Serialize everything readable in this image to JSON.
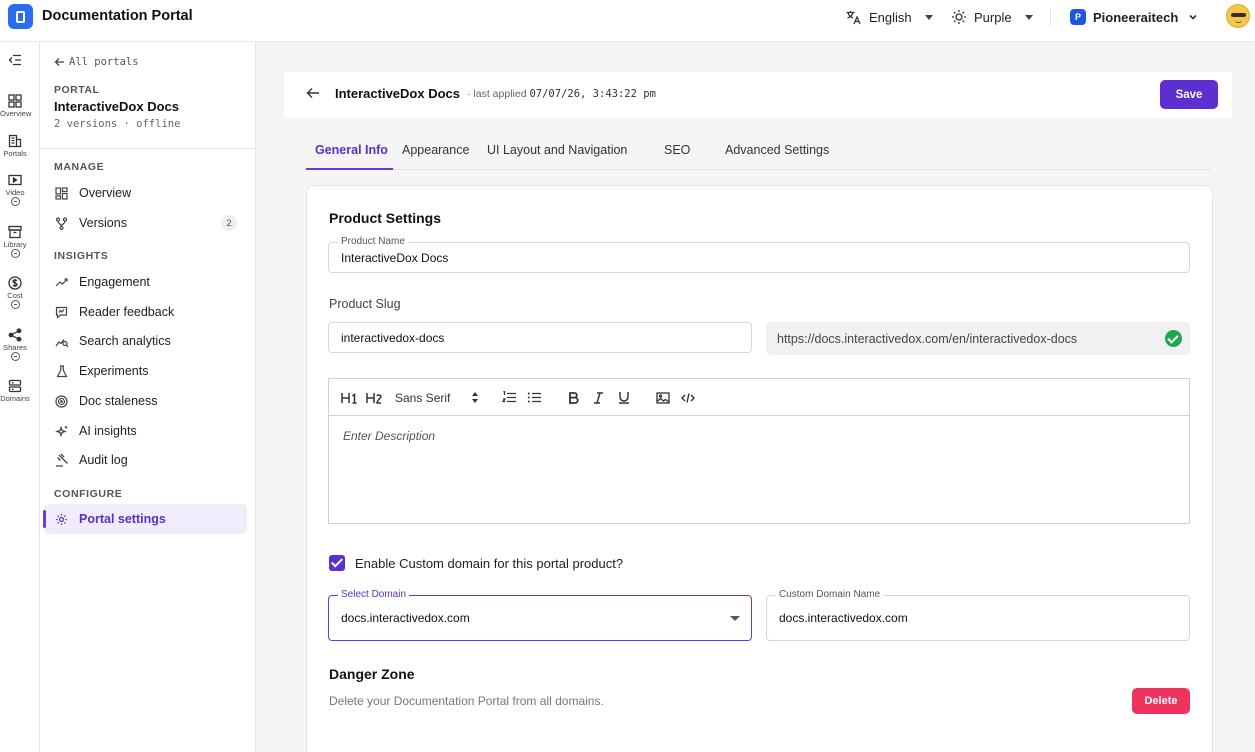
{
  "app": {
    "title": "Documentation Portal",
    "language": "English",
    "theme": "Purple",
    "org_initial": "P",
    "org_name": "Pioneeraitech"
  },
  "rail": {
    "items": [
      {
        "label": "Overview",
        "icon": "grid-icon"
      },
      {
        "label": "Portals",
        "icon": "building-icon"
      },
      {
        "label": "Video",
        "icon": "video-icon"
      },
      {
        "label": "Library",
        "icon": "archive-icon"
      },
      {
        "label": "Cost",
        "icon": "dollar-icon"
      },
      {
        "label": "Shares",
        "icon": "share-icon"
      },
      {
        "label": "Domains",
        "icon": "server-icon"
      }
    ]
  },
  "nav": {
    "back_label": "All portals",
    "portal_label": "PORTAL",
    "portal_name": "InteractiveDox Docs",
    "portal_meta": "2 versions · offline",
    "manage_title": "MANAGE",
    "insights_title": "INSIGHTS",
    "configure_title": "CONFIGURE",
    "manage": [
      {
        "label": "Overview",
        "icon": "grid-icon"
      },
      {
        "label": "Versions",
        "icon": "branch-icon",
        "count": "2"
      }
    ],
    "insights": [
      {
        "label": "Engagement",
        "icon": "trend-icon"
      },
      {
        "label": "Reader feedback",
        "icon": "feedback-icon"
      },
      {
        "label": "Search analytics",
        "icon": "search-analytics-icon"
      },
      {
        "label": "Experiments",
        "icon": "flask-icon"
      },
      {
        "label": "Doc staleness",
        "icon": "radar-icon"
      },
      {
        "label": "AI insights",
        "icon": "sparkle-icon"
      },
      {
        "label": "Audit log",
        "icon": "gavel-icon"
      }
    ],
    "configure": [
      {
        "label": "Portal settings",
        "icon": "gear-icon"
      }
    ]
  },
  "header": {
    "title": "InteractiveDox Docs",
    "last_applied_label": "· last applied",
    "last_applied_value": "07/07/26, 3:43:22 pm",
    "save_label": "Save"
  },
  "tabs": [
    "General Info",
    "Appearance",
    "UI Layout and Navigation",
    "SEO",
    "Advanced Settings"
  ],
  "form": {
    "section_title": "Product Settings",
    "product_name_label": "Product Name",
    "product_name_value": "InteractiveDox Docs",
    "slug_label": "Product Slug",
    "slug_value": "interactivedox-docs",
    "slug_url": "https://docs.interactivedox.com/en/interactivedox-docs",
    "editor": {
      "h1": "H1",
      "h2": "H2",
      "font": "Sans Serif",
      "placeholder": "Enter Description"
    },
    "custom_domain_checkbox_label": "Enable Custom domain for this portal product?",
    "custom_domain_checked": true,
    "select_domain_label": "Select Domain",
    "select_domain_value": "docs.interactivedox.com",
    "custom_domain_name_label": "Custom Domain Name",
    "custom_domain_name_value": "docs.interactivedox.com",
    "danger_title": "Danger Zone",
    "danger_desc": "Delete your Documentation Portal from all domains.",
    "delete_label": "Delete"
  },
  "colors": {
    "accent": "#5d2fd0",
    "danger": "#f0325f",
    "success": "#1fa84f",
    "brand_logo": "#2b6cf0"
  }
}
